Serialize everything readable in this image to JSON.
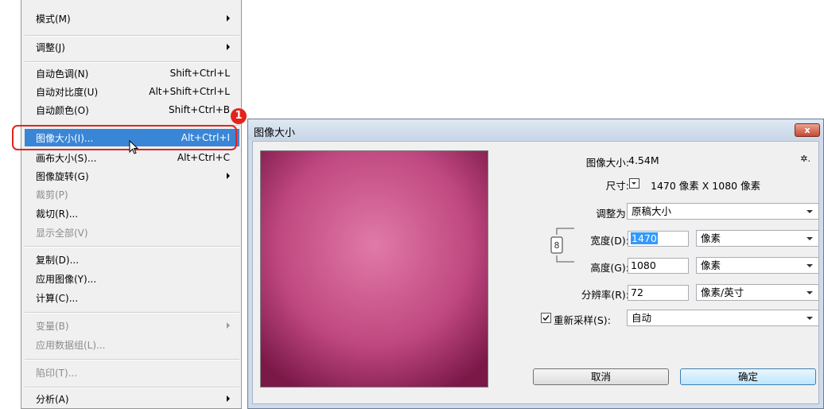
{
  "menu": {
    "items": [
      {
        "label": "模式(M)",
        "shortcut": "",
        "submenu": true,
        "disabled": false
      },
      {
        "label": "调整(J)",
        "shortcut": "",
        "submenu": true,
        "disabled": false
      },
      {
        "label": "自动色调(N)",
        "shortcut": "Shift+Ctrl+L",
        "submenu": false,
        "disabled": false
      },
      {
        "label": "自动对比度(U)",
        "shortcut": "Alt+Shift+Ctrl+L",
        "submenu": false,
        "disabled": false
      },
      {
        "label": "自动颜色(O)",
        "shortcut": "Shift+Ctrl+B",
        "submenu": false,
        "disabled": false
      },
      {
        "label": "图像大小(I)...",
        "shortcut": "Alt+Ctrl+I",
        "submenu": false,
        "disabled": false
      },
      {
        "label": "画布大小(S)...",
        "shortcut": "Alt+Ctrl+C",
        "submenu": false,
        "disabled": false
      },
      {
        "label": "图像旋转(G)",
        "shortcut": "",
        "submenu": true,
        "disabled": false
      },
      {
        "label": "裁剪(P)",
        "shortcut": "",
        "submenu": false,
        "disabled": true
      },
      {
        "label": "裁切(R)...",
        "shortcut": "",
        "submenu": false,
        "disabled": false
      },
      {
        "label": "显示全部(V)",
        "shortcut": "",
        "submenu": false,
        "disabled": true
      },
      {
        "label": "复制(D)...",
        "shortcut": "",
        "submenu": false,
        "disabled": false
      },
      {
        "label": "应用图像(Y)...",
        "shortcut": "",
        "submenu": false,
        "disabled": false
      },
      {
        "label": "计算(C)...",
        "shortcut": "",
        "submenu": false,
        "disabled": false
      },
      {
        "label": "变量(B)",
        "shortcut": "",
        "submenu": true,
        "disabled": true
      },
      {
        "label": "应用数据组(L)...",
        "shortcut": "",
        "submenu": false,
        "disabled": true
      },
      {
        "label": "陷印(T)...",
        "shortcut": "",
        "submenu": false,
        "disabled": true
      },
      {
        "label": "分析(A)",
        "shortcut": "",
        "submenu": true,
        "disabled": false
      }
    ]
  },
  "annotation": {
    "step": "1"
  },
  "dialog": {
    "title": "图像大小",
    "close_glyph": "x",
    "image_size_label": "图像大小:",
    "image_size_value": "4.54M",
    "gear_glyph": "✲.",
    "dimensions_label": "尺寸:",
    "dimensions_value": "1470 像素 X 1080 像素",
    "fit_to_label": "调整为:",
    "fit_to_value": "原稿大小",
    "width_label": "宽度(D):",
    "width_value": "1470",
    "width_unit": "像素",
    "height_label": "高度(G):",
    "height_value": "1080",
    "height_unit": "像素",
    "resolution_label": "分辨率(R):",
    "resolution_value": "72",
    "resolution_unit": "像素/英寸",
    "resample_label": "重新采样(S):",
    "resample_checked": true,
    "resample_value": "自动",
    "cancel_label": "取消",
    "ok_label": "确定"
  }
}
